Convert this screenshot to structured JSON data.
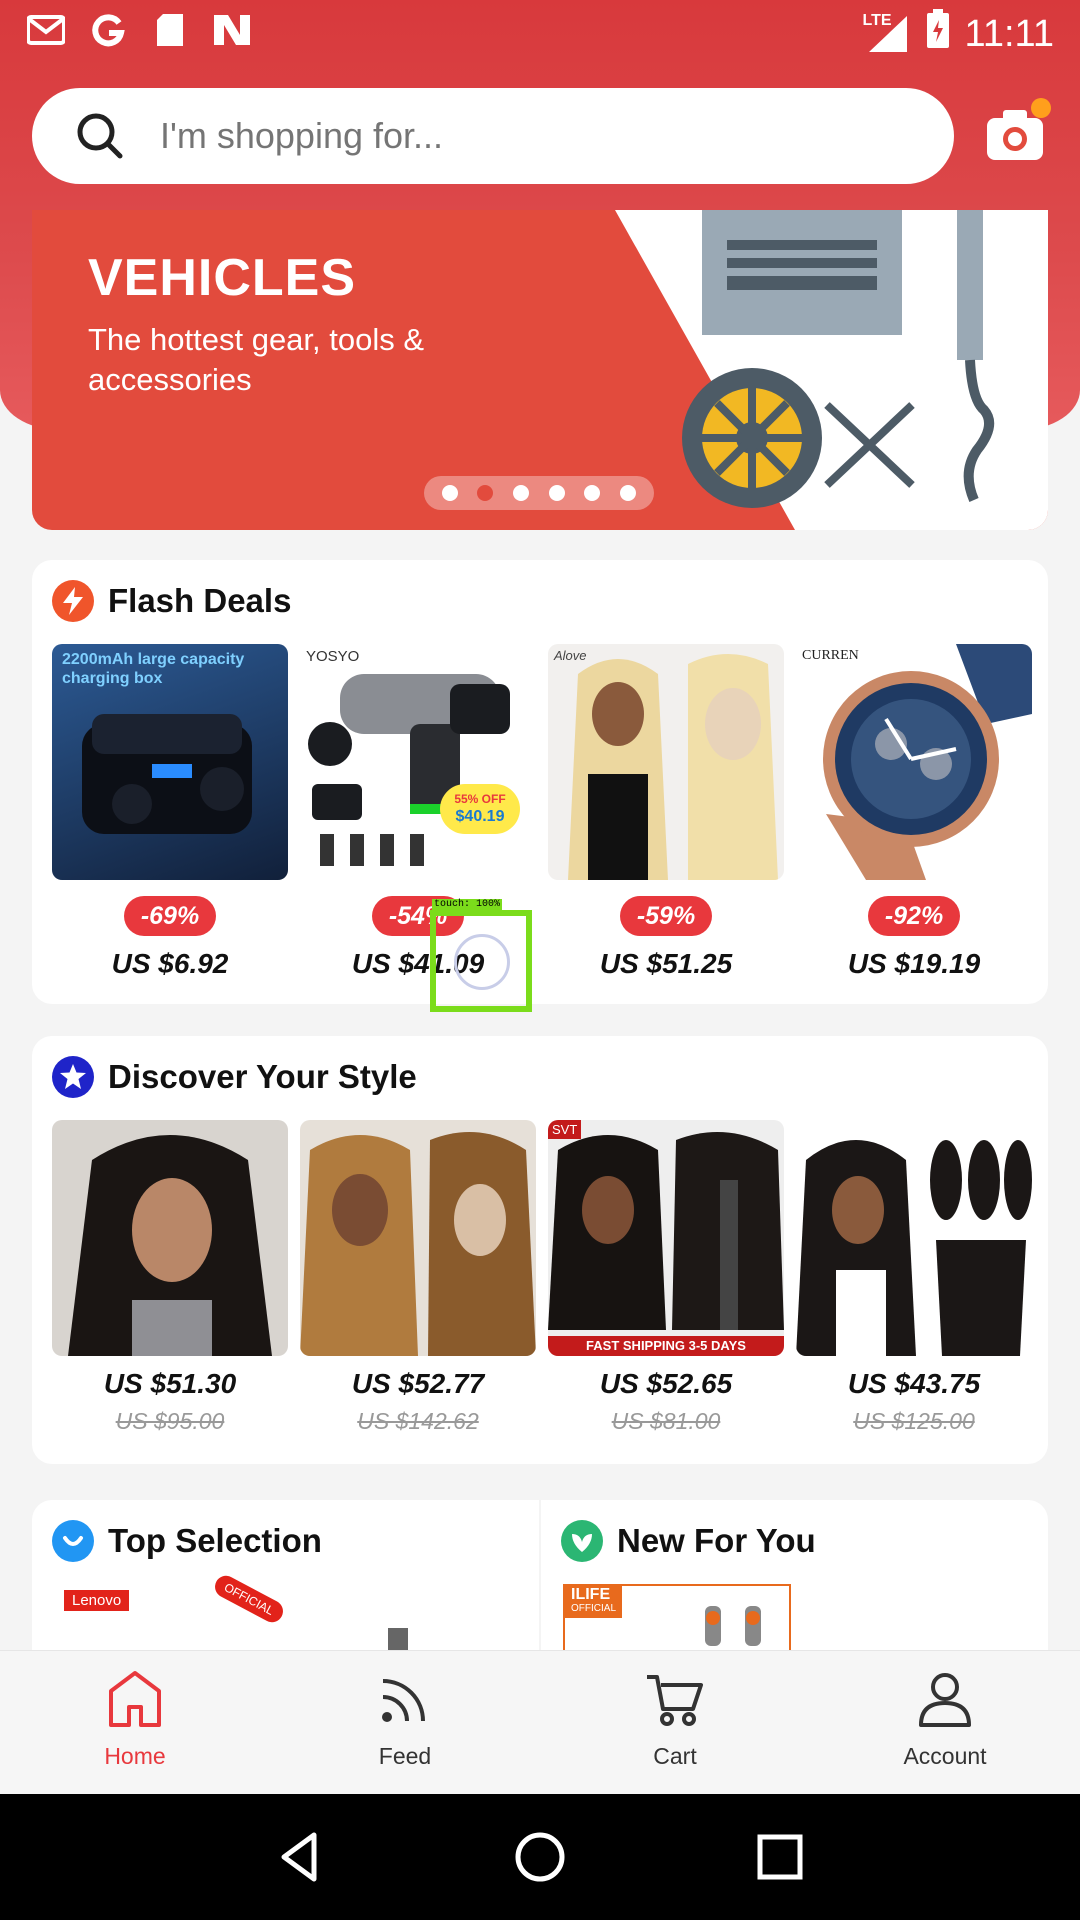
{
  "status": {
    "network": "LTE",
    "time": "11:11"
  },
  "search": {
    "placeholder": "I'm shopping for..."
  },
  "banner": {
    "title": "VEHICLES",
    "subtitle": "The hottest gear, tools & accessories",
    "slides": 6,
    "active_slide": 1
  },
  "flash_deals": {
    "title": "Flash Deals",
    "items": [
      {
        "discount": "-69%",
        "price": "US $6.92",
        "img_text": "2200mAh large capacity charging box"
      },
      {
        "discount": "-54%",
        "price": "US $41.09",
        "img_brand": "YOSYO",
        "img_sticker_top": "55% OFF",
        "img_sticker_price": "$40.19"
      },
      {
        "discount": "-59%",
        "price": "US $51.25",
        "img_brand": "Alove"
      },
      {
        "discount": "-92%",
        "price": "US $19.19",
        "img_brand": "CURREN"
      }
    ]
  },
  "discover": {
    "title": "Discover Your Style",
    "items": [
      {
        "price": "US $51.30",
        "old_price": "US $95.00"
      },
      {
        "price": "US $52.77",
        "old_price": "US $142.62"
      },
      {
        "price": "US $52.65",
        "old_price": "US $81.00",
        "img_strip": "FAST SHIPPING 3-5 DAYS",
        "img_brand": "SVT"
      },
      {
        "price": "US $43.75",
        "old_price": "US $125.00"
      }
    ]
  },
  "top_selection": {
    "title": "Top Selection",
    "brand": "Lenovo",
    "sticker": "OFFICIAL"
  },
  "new_for_you": {
    "title": "New For You",
    "brand": "ILIFE",
    "sub": "OFFICIAL"
  },
  "nav": {
    "home": "Home",
    "feed": "Feed",
    "cart": "Cart",
    "account": "Account"
  },
  "touch": {
    "label": "touch: 100%"
  },
  "colors": {
    "accent": "#e8383d",
    "header": "#d8393c",
    "badge_text": "#ffffff"
  }
}
